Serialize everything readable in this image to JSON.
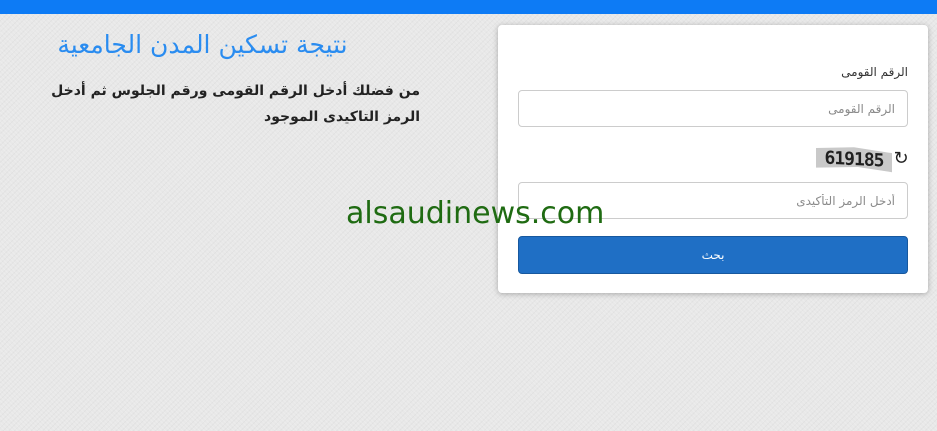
{
  "page": {
    "title": "نتيجة تسكين المدن الجامعية",
    "instruction": "من فضلك أدخل الرقم القومى ورقم الجلوس ثم أدخل الرمز التاكيدى الموجود"
  },
  "form": {
    "national_id_label": "الرقم القومى",
    "national_id_placeholder": "الرقم القومى",
    "captcha_code": "619185",
    "refresh_icon": "↻",
    "captcha_placeholder": "أدخل الرمز التأكيدى",
    "submit_label": "بحث"
  },
  "watermark": "alsaudinews.com",
  "colors": {
    "top_bar": "#0d7bf5",
    "heading": "#2a8cf0",
    "button": "#1f6fc5",
    "watermark": "#1f6b12"
  }
}
